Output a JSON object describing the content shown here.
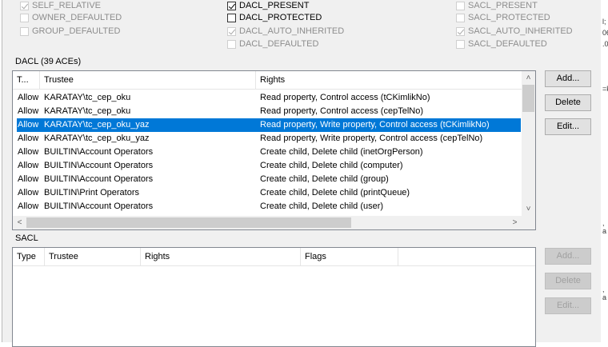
{
  "control_flags": [
    {
      "label": "SELF_RELATIVE",
      "checked": true,
      "enabled": false,
      "col": 0,
      "row": 0
    },
    {
      "label": "OWNER_DEFAULTED",
      "checked": false,
      "enabled": false,
      "col": 0,
      "row": 1
    },
    {
      "label": "GROUP_DEFAULTED",
      "checked": false,
      "enabled": false,
      "col": 0,
      "row": 2
    },
    {
      "label": "DACL_PRESENT",
      "checked": true,
      "enabled": true,
      "col": 1,
      "row": 0
    },
    {
      "label": "DACL_PROTECTED",
      "checked": false,
      "enabled": true,
      "col": 1,
      "row": 1
    },
    {
      "label": "DACL_AUTO_INHERITED",
      "checked": true,
      "enabled": false,
      "col": 1,
      "row": 2
    },
    {
      "label": "DACL_DEFAULTED",
      "checked": false,
      "enabled": false,
      "col": 1,
      "row": 3
    },
    {
      "label": "SACL_PRESENT",
      "checked": false,
      "enabled": false,
      "col": 2,
      "row": 0
    },
    {
      "label": "SACL_PROTECTED",
      "checked": false,
      "enabled": false,
      "col": 2,
      "row": 1
    },
    {
      "label": "SACL_AUTO_INHERITED",
      "checked": true,
      "enabled": false,
      "col": 2,
      "row": 2
    },
    {
      "label": "SACL_DEFAULTED",
      "checked": false,
      "enabled": false,
      "col": 2,
      "row": 3
    }
  ],
  "dacl": {
    "label": "DACL (39 ACEs)",
    "columns": [
      "T...",
      "Trustee",
      "Rights"
    ],
    "selected_index": 2,
    "rows": [
      [
        "Allow",
        "KARATAY\\tc_cep_oku",
        "Read property, Control access (tCKimlikNo)"
      ],
      [
        "Allow",
        "KARATAY\\tc_cep_oku",
        "Read property, Control access (cepTelNo)"
      ],
      [
        "Allow",
        "KARATAY\\tc_cep_oku_yaz",
        "Read property, Write property, Control access (tCKimlikNo)"
      ],
      [
        "Allow",
        "KARATAY\\tc_cep_oku_yaz",
        "Read property, Write property, Control access (cepTelNo)"
      ],
      [
        "Allow",
        "BUILTIN\\Account Operators",
        "Create child, Delete child (inetOrgPerson)"
      ],
      [
        "Allow",
        "BUILTIN\\Account Operators",
        "Create child, Delete child (computer)"
      ],
      [
        "Allow",
        "BUILTIN\\Account Operators",
        "Create child, Delete child (group)"
      ],
      [
        "Allow",
        "BUILTIN\\Print Operators",
        "Create child, Delete child (printQueue)"
      ],
      [
        "Allow",
        "BUILTIN\\Account Operators",
        "Create child, Delete child (user)"
      ]
    ],
    "buttons": {
      "add": "Add...",
      "delete": "Delete",
      "edit": "Edit..."
    }
  },
  "sacl": {
    "label": "SACL",
    "columns": [
      "Type",
      "Trustee",
      "Rights",
      "Flags",
      ""
    ],
    "buttons": {
      "add": "Add...",
      "delete": "Delete",
      "edit": "Edit..."
    }
  },
  "background_fragments": [
    "l;",
    "06",
    ".0",
    "=k",
    ", a",
    ", a"
  ]
}
